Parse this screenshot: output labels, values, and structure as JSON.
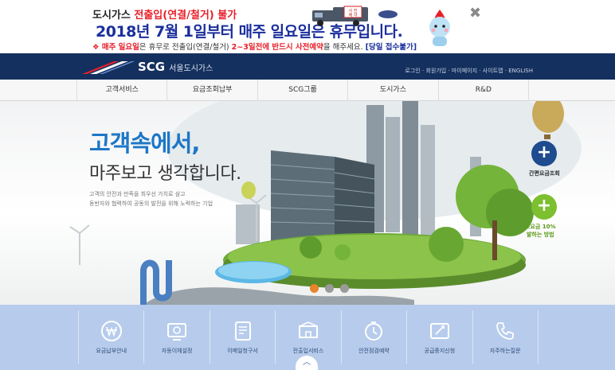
{
  "notice": {
    "line1_prefix": "도시가스 ",
    "line1_red": "전출입(연결/철거) 불가",
    "line2": "2018년 7월 1일부터 매주 일요일은 휴무입니다.",
    "line3_bullet": "❖ ",
    "line3_red": "매주 일요일",
    "line3_mid": "은 휴무로 전출입(연결/철거) ",
    "line3_red2": "2~3일전에 반드시 사전예약",
    "line3_tail": "을 해주세요. ",
    "line3_blue": "[당일 접수불가]",
    "truck_sign": "사전예약",
    "close_icon": "✖"
  },
  "header": {
    "brand": "SCG",
    "company": "서울도시가스",
    "util_links": [
      "로그인",
      "회원가입",
      "마이페이지",
      "사이트맵",
      "ENGLISH"
    ],
    "util_sep": " · "
  },
  "gnb": {
    "items": [
      "고객서비스",
      "요금조회납부",
      "SCG그룹",
      "도시가스",
      "R&D"
    ]
  },
  "hero": {
    "title1": "고객속에서,",
    "title2": "마주보고 생각합니다.",
    "desc_line1": "고객의 안전과 만족을 최우선 가치로 삼고",
    "desc_line2": "동반자와 협력하여 공동의 발전을 위해 노력하는 기업",
    "btn1_icon": "+",
    "btn1_label": "간편요금조회",
    "btn2_icon": "+",
    "btn2_label_line1": "스요금 10%",
    "btn2_label_line2": "발하는 방법",
    "slide_count": 3,
    "active_slide": 1
  },
  "quick": {
    "items": [
      {
        "label": "요금납부안내",
        "icon": "won-coin-icon"
      },
      {
        "label": "자동이체설정",
        "icon": "auto-transfer-icon"
      },
      {
        "label": "이메일청구서",
        "icon": "email-bill-icon"
      },
      {
        "label": "전출입서비스",
        "icon": "move-service-icon"
      },
      {
        "label": "안전점검예약",
        "icon": "safety-check-icon"
      },
      {
        "label": "공급중지신청",
        "icon": "supply-stop-icon"
      },
      {
        "label": "자주하는질문",
        "icon": "faq-phone-icon"
      }
    ],
    "up_arrow": "︿"
  },
  "colors": {
    "header_navy": "#14305e",
    "title_blue": "#1d77c6",
    "notice_red": "#e8202a",
    "notice_blue": "#1b2f9c",
    "quick_bg": "#b7ccec",
    "active_dot": "#e8842a",
    "green_btn": "#7cbf2f"
  }
}
